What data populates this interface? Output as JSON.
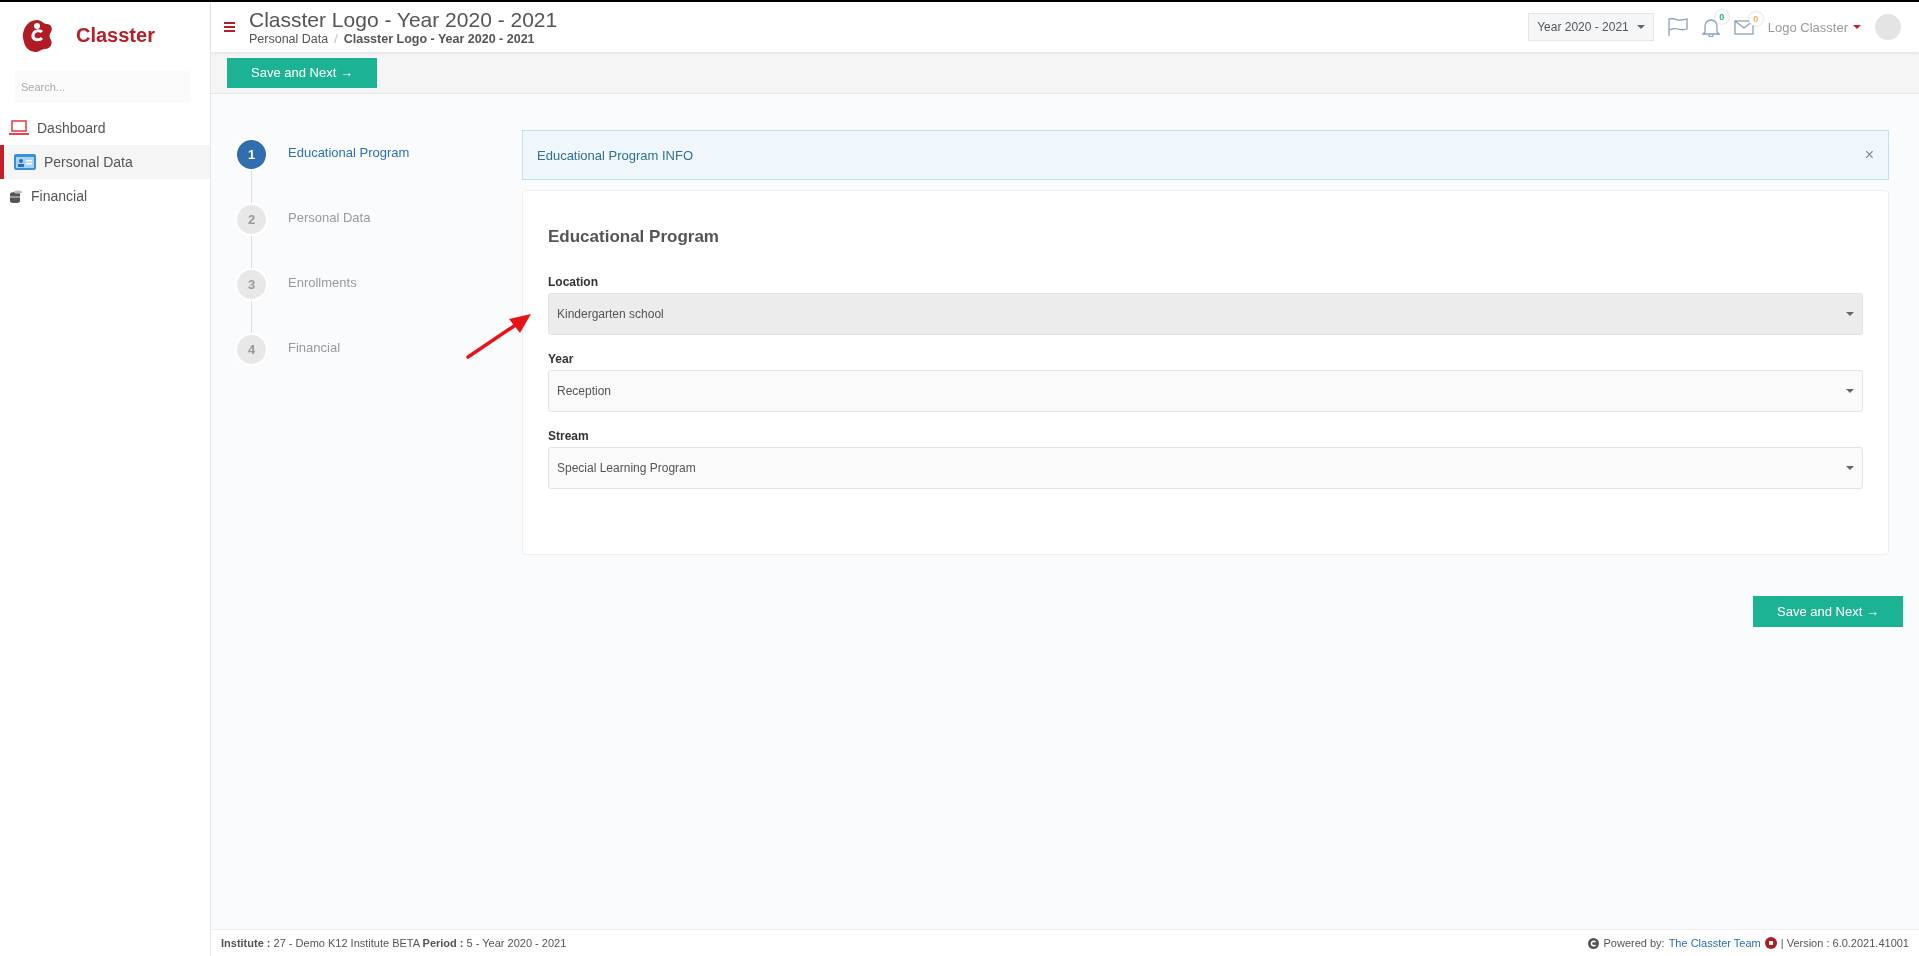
{
  "sidebar": {
    "brand": "Classter",
    "search": {
      "placeholder": "Search..."
    },
    "items": [
      {
        "label": "Dashboard",
        "kind": "laptop",
        "selected": false
      },
      {
        "label": "Personal Data",
        "kind": "card",
        "selected": true
      },
      {
        "label": "Financial",
        "kind": "coins",
        "selected": false
      }
    ]
  },
  "header": {
    "title": "Classter Logo - Year 2020 - 2021",
    "breadcrumb": [
      "Personal Data",
      "Classter Logo - Year 2020 - 2021"
    ],
    "breadcrumb_separator": "/",
    "period_select": "Year 2020 - 2021",
    "notifications": "0",
    "messages": "0",
    "user": "Logo Classter"
  },
  "toolbar": {
    "save_button": "Save and Next →"
  },
  "steps": [
    {
      "number": "1",
      "label": "Educational Program",
      "selected": true
    },
    {
      "number": "2",
      "label": "Personal Data",
      "selected": false
    },
    {
      "number": "3",
      "label": "Enrollments",
      "selected": false
    },
    {
      "number": "4",
      "label": "Financial",
      "selected": false
    }
  ],
  "info": {
    "text": "Educational Program INFO",
    "close": "×"
  },
  "form": {
    "title": "Educational Program",
    "fields": [
      {
        "label": "Location",
        "value": "Kindergarten school",
        "disabled": true
      },
      {
        "label": "Year",
        "value": "Reception",
        "disabled": false
      },
      {
        "label": "Stream",
        "value": "Special Learning Program",
        "disabled": false
      }
    ]
  },
  "bottom_button": "Save and Next →",
  "footer": {
    "left": "**Institute :** 27 - Demo K12 Institute BETA **Period :** 5 - Year 2020 - 2021",
    "powered": "Powered by:",
    "link": "The Classter Team",
    "version": "| Version : 6.0.2021.41001"
  }
}
